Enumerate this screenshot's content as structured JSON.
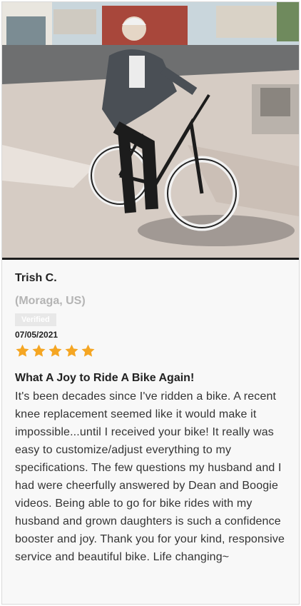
{
  "review": {
    "photo_alt": "woman-on-bike-photo",
    "reviewer_name": "Trish C.",
    "reviewer_location": "(Moraga, US)",
    "verified_label": "Verified",
    "date": "07/05/2021",
    "rating": 5,
    "title": "What A Joy to Ride A Bike Again!",
    "body": "It's been decades since I've ridden a bike. A recent knee replacement seemed like it would make it impossible...until I received your bike! It really was easy to customize/adjust everything to my specifications. The few questions my husband and I had were cheerfully answered by Dean and Boogie videos. Being able to go for bike rides with my husband and grown daughters is such a confidence booster and joy. Thank you for your kind, responsive service and beautiful bike. Life changing~"
  },
  "colors": {
    "star": "#f5a623",
    "card_bg": "#f8f8f8",
    "muted": "#b4b4b4"
  }
}
